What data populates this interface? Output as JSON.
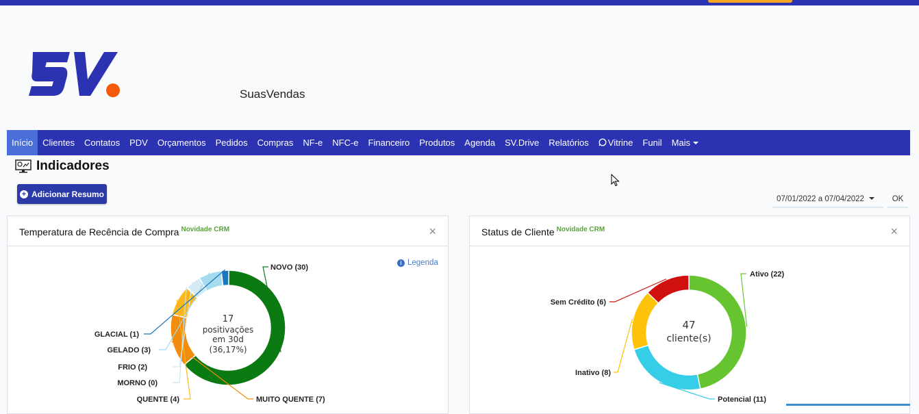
{
  "brand": {
    "logo_text": "SV",
    "name": "SuasVendas"
  },
  "nav": [
    {
      "label": "Início",
      "active": true
    },
    {
      "label": "Clientes"
    },
    {
      "label": "Contatos"
    },
    {
      "label": "PDV"
    },
    {
      "label": "Orçamentos"
    },
    {
      "label": "Pedidos"
    },
    {
      "label": "Compras"
    },
    {
      "label": "NF-e"
    },
    {
      "label": "NFC-e"
    },
    {
      "label": "Financeiro"
    },
    {
      "label": "Produtos"
    },
    {
      "label": "Agenda"
    },
    {
      "label": "SV.Drive"
    },
    {
      "label": "Relatórios"
    },
    {
      "label": "Vitrine",
      "icon": "whatsapp-icon"
    },
    {
      "label": "Funil"
    },
    {
      "label": "Mais",
      "dropdown": true
    }
  ],
  "page": {
    "title": "Indicadores",
    "add_button": "Adicionar Resumo"
  },
  "filters": {
    "date_range": "07/01/2022 a 07/04/2022",
    "ok": "OK"
  },
  "cards": [
    {
      "title": "Temperatura de Recência de Compra",
      "badge": "Novidade CRM",
      "legend_link": "Legenda",
      "center": [
        "17",
        "positivações",
        "em 30d",
        "(36,17%)"
      ],
      "chart_data": {
        "type": "pie",
        "series": [
          {
            "name": "NOVO (30)",
            "value": 30,
            "color": "#0b7a12"
          },
          {
            "name": "MUITO QUENTE (7)",
            "value": 7,
            "color": "#f28c0c"
          },
          {
            "name": "QUENTE (4)",
            "value": 4,
            "color": "#fbb71b"
          },
          {
            "name": "MORNO (0)",
            "value": 0,
            "color": "#c7e3ef"
          },
          {
            "name": "FRIO (2)",
            "value": 2,
            "color": "#d5ebf3"
          },
          {
            "name": "GELADO (3)",
            "value": 3,
            "color": "#a4dbef"
          },
          {
            "name": "GLACIAL (1)",
            "value": 1,
            "color": "#1d76b8"
          }
        ]
      }
    },
    {
      "title": "Status de Cliente",
      "badge": "Novidade CRM",
      "center": [
        "47",
        "cliente(s)"
      ],
      "chart_data": {
        "type": "pie",
        "series": [
          {
            "name": "Ativo (22)",
            "value": 22,
            "color": "#66c430"
          },
          {
            "name": "Potencial (11)",
            "value": 11,
            "color": "#35cde8"
          },
          {
            "name": "Inativo (8)",
            "value": 8,
            "color": "#fdc20a"
          },
          {
            "name": "Sem Crédito (6)",
            "value": 6,
            "color": "#d0100f"
          }
        ]
      }
    }
  ]
}
